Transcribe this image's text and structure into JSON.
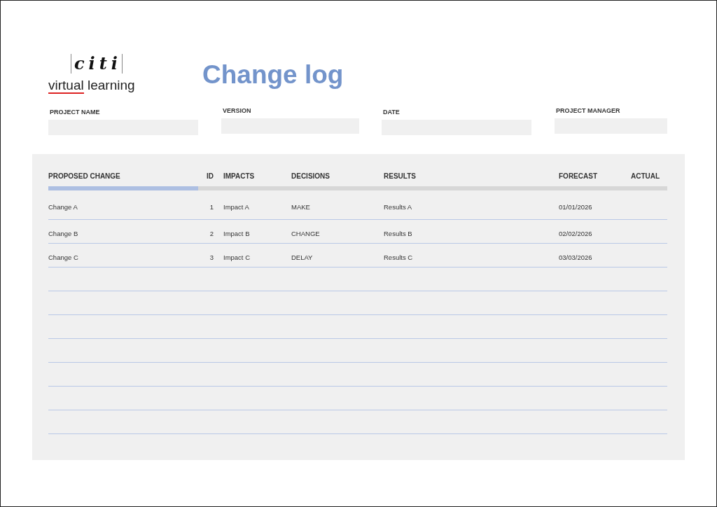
{
  "logo": {
    "mark": "citi",
    "tagline_underlined": "virtual",
    "tagline_rest": "learning"
  },
  "title": "Change log",
  "fields": [
    {
      "label": "PROJECT NAME"
    },
    {
      "label": "VERSION"
    },
    {
      "label": "DATE"
    },
    {
      "label": "PROJECT MANAGER"
    }
  ],
  "table": {
    "columns": [
      {
        "label": "PROPOSED CHANGE",
        "accent": true
      },
      {
        "label": "ID",
        "accent": false
      },
      {
        "label": "IMPACTS",
        "accent": false
      },
      {
        "label": "DECISIONS",
        "accent": false
      },
      {
        "label": "RESULTS",
        "accent": false
      },
      {
        "label": "FORECAST",
        "accent": false
      },
      {
        "label": "ACTUAL",
        "accent": false
      }
    ],
    "rows": [
      [
        "Change A",
        "1",
        "Impact A",
        "MAKE",
        "Results A",
        "01/01/2026"
      ],
      [
        "Change B",
        "2",
        "Impact B",
        "CHANGE",
        "Results B",
        "02/02/2026"
      ],
      [
        "Change C",
        "3",
        "Impact C",
        "DELAY",
        "Results C",
        "03/03/2026"
      ]
    ]
  }
}
